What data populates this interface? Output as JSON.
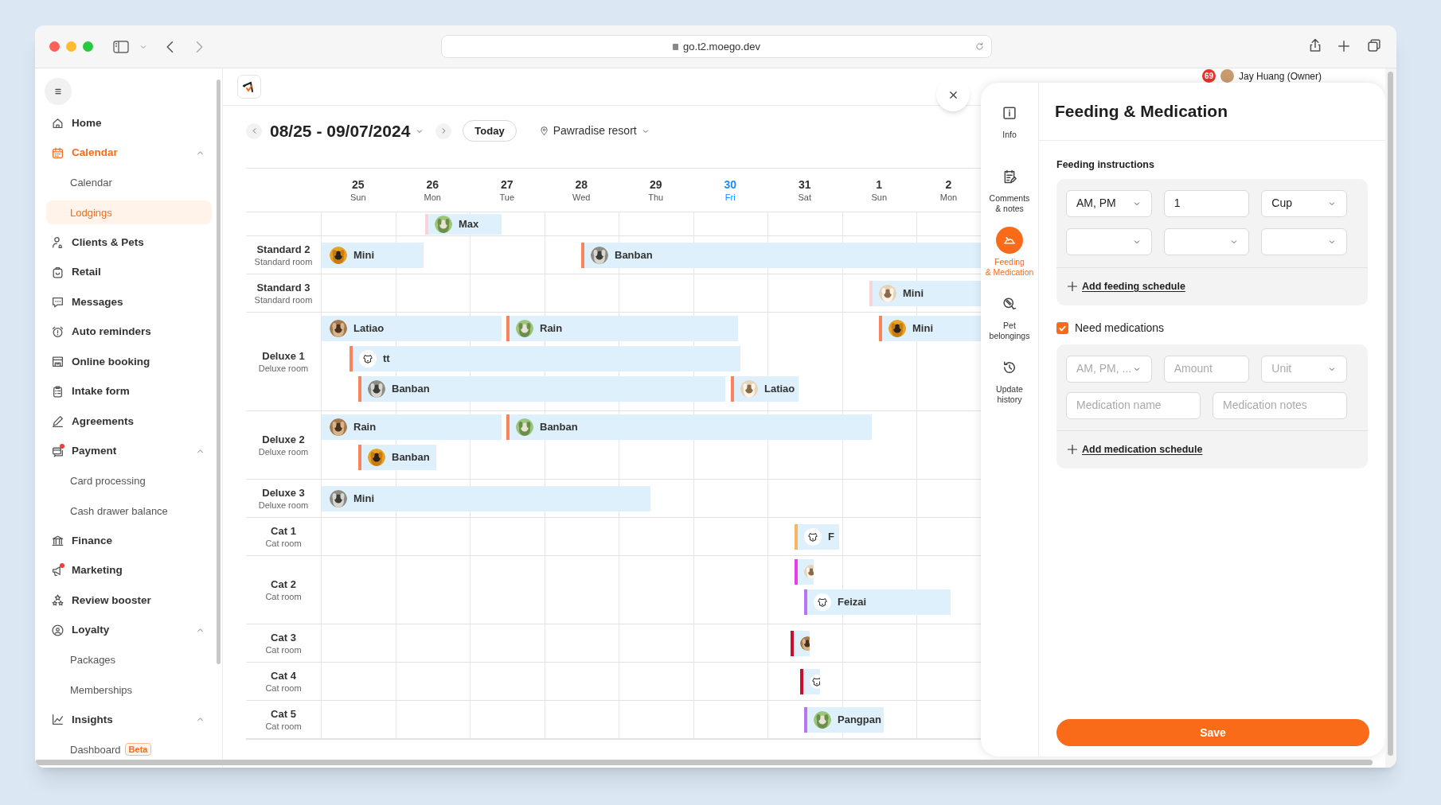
{
  "browser": {
    "url": "go.t2.moego.dev"
  },
  "sidebar": {
    "items": [
      {
        "label": "Home",
        "selected": false,
        "dot": false
      },
      {
        "label": "Calendar",
        "selected": true,
        "dot": false,
        "expanded": true,
        "children": [
          {
            "label": "Calendar",
            "selected": false
          },
          {
            "label": "Lodgings",
            "selected": true
          }
        ]
      },
      {
        "label": "Clients & Pets",
        "selected": false,
        "dot": false
      },
      {
        "label": "Retail",
        "selected": false,
        "dot": false
      },
      {
        "label": "Messages",
        "selected": false,
        "dot": false
      },
      {
        "label": "Auto reminders",
        "selected": false,
        "dot": false
      },
      {
        "label": "Online booking",
        "selected": false,
        "dot": false
      },
      {
        "label": "Intake form",
        "selected": false,
        "dot": false
      },
      {
        "label": "Agreements",
        "selected": false,
        "dot": false
      },
      {
        "label": "Payment",
        "selected": false,
        "dot": true,
        "expanded": true,
        "children": [
          {
            "label": "Card processing",
            "selected": false
          },
          {
            "label": "Cash drawer balance",
            "selected": false
          }
        ]
      },
      {
        "label": "Finance",
        "selected": false,
        "dot": false
      },
      {
        "label": "Marketing",
        "selected": false,
        "dot": true
      },
      {
        "label": "Review booster",
        "selected": false,
        "dot": false
      },
      {
        "label": "Loyalty",
        "selected": false,
        "dot": false,
        "expanded": true,
        "children": [
          {
            "label": "Packages",
            "selected": false
          },
          {
            "label": "Memberships",
            "selected": false
          }
        ]
      },
      {
        "label": "Insights",
        "selected": false,
        "dot": false,
        "expanded": true,
        "children": [
          {
            "label": "Dashboard",
            "selected": false,
            "badge": "Beta"
          }
        ]
      }
    ]
  },
  "header": {
    "notification_count": "69",
    "user_name": "Jay Huang (Owner)"
  },
  "calendar": {
    "date_range": "08/25 - 09/07/2024",
    "today_button": "Today",
    "location": "Pawradise resort",
    "days": [
      {
        "date": "25",
        "weekday": "Sun",
        "today": false
      },
      {
        "date": "26",
        "weekday": "Mon",
        "today": false
      },
      {
        "date": "27",
        "weekday": "Tue",
        "today": false
      },
      {
        "date": "28",
        "weekday": "Wed",
        "today": false
      },
      {
        "date": "29",
        "weekday": "Thu",
        "today": false
      },
      {
        "date": "30",
        "weekday": "Fri",
        "today": true
      },
      {
        "date": "31",
        "weekday": "Sat",
        "today": false
      },
      {
        "date": "1",
        "weekday": "Sun",
        "today": false
      },
      {
        "date": "2",
        "weekday": "Mon",
        "today": false
      }
    ],
    "rows": [
      {
        "lanes": [
          [
            {
              "pet": "Max",
              "kind": "picture",
              "color": "#f9d3da"
            }
          ]
        ]
      },
      {
        "name": "Standard 2",
        "type": "Standard room",
        "lanes": [
          [
            {
              "pet": "Mini",
              "kind": "picture"
            },
            {
              "pet": "Banban",
              "kind": "picture",
              "color": "#f7845a"
            }
          ]
        ]
      },
      {
        "name": "Standard 3",
        "type": "Standard room",
        "lanes": [
          [
            {
              "pet": "Mini",
              "kind": "picture",
              "color": "#f9d3da"
            }
          ]
        ]
      },
      {
        "name": "Deluxe 1",
        "type": "Deluxe room",
        "lanes": [
          [
            {
              "pet": "Latiao",
              "kind": "picture"
            },
            {
              "pet": "Rain",
              "kind": "picture",
              "color": "#f7845a"
            },
            {
              "pet": "Mini",
              "kind": "picture",
              "color": "#f7845a"
            }
          ],
          [
            {
              "pet": "tt",
              "kind": "icon",
              "color": "#f7845a"
            }
          ],
          [
            {
              "pet": "Banban",
              "kind": "picture",
              "color": "#f7845a"
            },
            {
              "pet": "Latiao",
              "kind": "picture",
              "color": "#f7845a"
            }
          ]
        ]
      },
      {
        "name": "Deluxe 2",
        "type": "Deluxe room",
        "lanes": [
          [
            {
              "pet": "Rain",
              "kind": "picture"
            },
            {
              "pet": "Banban",
              "kind": "picture",
              "color": "#f7845a"
            }
          ],
          [
            {
              "pet": "Banban",
              "kind": "picture",
              "color": "#f7845a"
            }
          ]
        ]
      },
      {
        "name": "Deluxe 3",
        "type": "Deluxe room",
        "lanes": [
          [
            {
              "pet": "Mini",
              "kind": "picture"
            }
          ]
        ]
      },
      {
        "name": "Cat 1",
        "type": "Cat room",
        "lanes": [
          [
            {
              "pet": "F",
              "kind": "icon",
              "color": "#f7b562"
            }
          ]
        ]
      },
      {
        "name": "Cat 2",
        "type": "Cat room",
        "lanes": [
          [
            {
              "kind": "picture",
              "color": "#e73ee7"
            }
          ],
          [
            {
              "pet": "Feizai",
              "kind": "icon",
              "color": "#b675f2"
            }
          ]
        ]
      },
      {
        "name": "Cat 3",
        "type": "Cat room",
        "lanes": [
          [
            {
              "kind": "picture",
              "color": "#c8102e"
            }
          ]
        ]
      },
      {
        "name": "Cat 4",
        "type": "Cat room",
        "lanes": [
          [
            {
              "kind": "icon",
              "color": "#c8102e"
            }
          ]
        ]
      },
      {
        "name": "Cat 5",
        "type": "Cat room",
        "lanes": [
          [
            {
              "pet": "Pangpan",
              "kind": "picture",
              "color": "#b675f2"
            }
          ]
        ]
      }
    ]
  },
  "panel": {
    "tabs": [
      {
        "label": "Info",
        "selected": false
      },
      {
        "label": "Comments\n& notes",
        "selected": false
      },
      {
        "label": "Feeding\n& Medication",
        "selected": true
      },
      {
        "label": "Pet\nbelongings",
        "selected": false
      },
      {
        "label": "Update\nhistory",
        "selected": false
      }
    ],
    "title": "Feeding & Medication",
    "feeding": {
      "heading": "Feeding instructions",
      "rows": [
        [
          {
            "kind": "select",
            "value": "AM, PM"
          },
          {
            "kind": "input",
            "value": "1"
          },
          {
            "kind": "select",
            "value": "Cup"
          }
        ],
        [
          {
            "kind": "select"
          },
          {
            "kind": "select"
          },
          {
            "kind": "select"
          }
        ]
      ],
      "add_link": "Add feeding schedule"
    },
    "medications": {
      "label": "Need medications",
      "checked": true,
      "schedule_fields": [
        {
          "kind": "select",
          "placeholder": "AM, PM, ..."
        },
        {
          "kind": "input",
          "placeholder": "Amount"
        },
        {
          "kind": "select",
          "placeholder": "Unit"
        }
      ],
      "detail_fields": [
        {
          "kind": "input",
          "placeholder": "Medication name"
        },
        {
          "kind": "input",
          "placeholder": "Medication notes"
        }
      ],
      "add_link": "Add medication schedule"
    },
    "save_button": "Save"
  }
}
